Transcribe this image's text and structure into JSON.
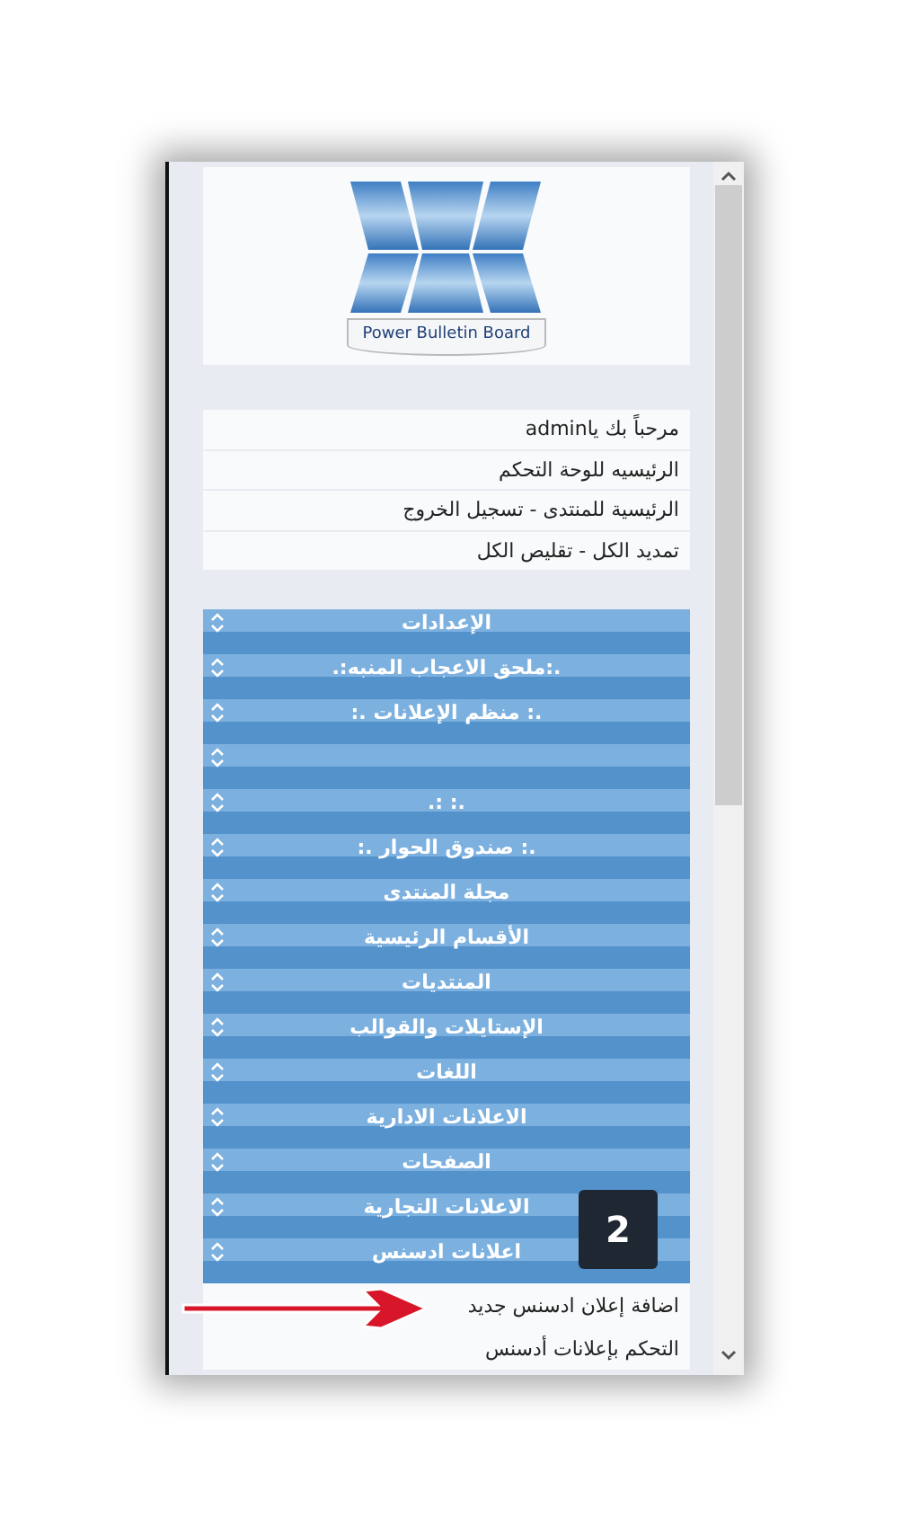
{
  "logo": {
    "caption": "Power Bulletin Board"
  },
  "links": [
    {
      "text": "مرحباً بك ياadmin"
    },
    {
      "text": "الرئيسيه للوحة التحكم"
    },
    {
      "text": "الرئيسية للمنتدى - تسجيل الخروج"
    },
    {
      "text": "تمديد الكل - تقليص الكل"
    }
  ],
  "sections": [
    {
      "kind": "titled",
      "title": "الإعدادات"
    },
    {
      "kind": "titled",
      "title": ".:ملحق الاعجاب المنبه:."
    },
    {
      "kind": "titled",
      "title": ".: منظم الإعلانات .:"
    },
    {
      "kind": "blank"
    },
    {
      "kind": "titled",
      "title": ".: :."
    },
    {
      "kind": "titled",
      "title": ".: صندوق الحوار .:"
    },
    {
      "kind": "titled",
      "title": "مجلة المنتدى"
    },
    {
      "kind": "titled",
      "title": "الأقسام الرئيسية"
    },
    {
      "kind": "titled",
      "title": "المنتديات"
    },
    {
      "kind": "titled",
      "title": "الإستايلات والقوالب"
    },
    {
      "kind": "titled",
      "title": "اللغات"
    },
    {
      "kind": "titled",
      "title": "الاعلانات الادارية"
    },
    {
      "kind": "titled",
      "title": "الصفحات"
    },
    {
      "kind": "titled",
      "title": "الاعلانات التجارية"
    },
    {
      "kind": "titled",
      "title": "اعلانات ادسنس"
    }
  ],
  "subitems": [
    {
      "text": "اضافة إعلان ادسنس جديد"
    },
    {
      "text": "التحكم بإعلانات أدسنس"
    }
  ],
  "badge": "2"
}
